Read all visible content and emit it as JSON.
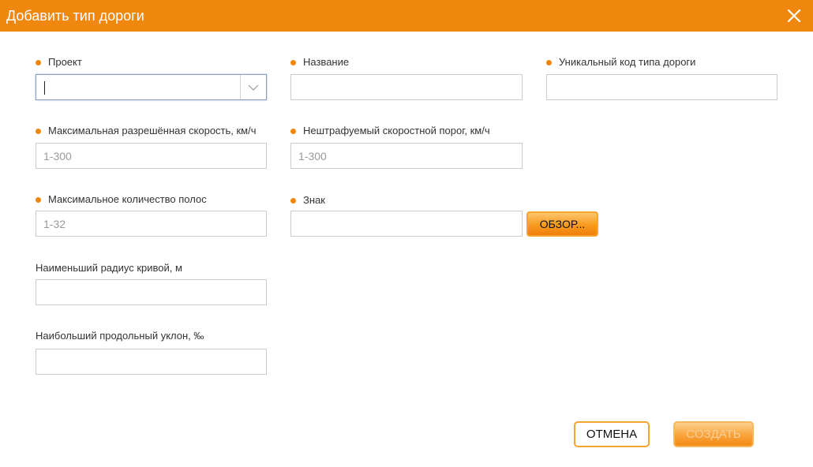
{
  "dialog": {
    "title": "Добавить тип дороги",
    "close_icon": "close-icon",
    "accent_color": "#f0870e"
  },
  "fields": {
    "project": {
      "label": "Проект",
      "value": "",
      "required": true,
      "icon": "chevron-down-icon"
    },
    "name": {
      "label": "Название",
      "value": "",
      "required": true
    },
    "unique_code": {
      "label": "Уникальный код типа дороги",
      "value": "",
      "required": true
    },
    "max_speed": {
      "label": "Максимальная разрешённая скорость, км/ч",
      "placeholder": "1-300",
      "required": true
    },
    "speed_threshold": {
      "label": "Нештрафуемый скоростной порог, км/ч",
      "placeholder": "1-300",
      "required": true
    },
    "max_lanes": {
      "label": "Максимальное количество полос",
      "placeholder": "1-32",
      "required": true
    },
    "sign": {
      "label": "Знак",
      "value": "",
      "required": true,
      "browse_label": "ОБЗОР..."
    },
    "min_radius": {
      "label": "Наименьший радиус кривой, м",
      "value": "",
      "required": false
    },
    "max_slope": {
      "label": "Наибольший продольный уклон, ‰",
      "value": "",
      "required": false
    }
  },
  "actions": {
    "cancel_label": "ОТМЕНА",
    "create_label": "СОЗДАТЬ"
  }
}
